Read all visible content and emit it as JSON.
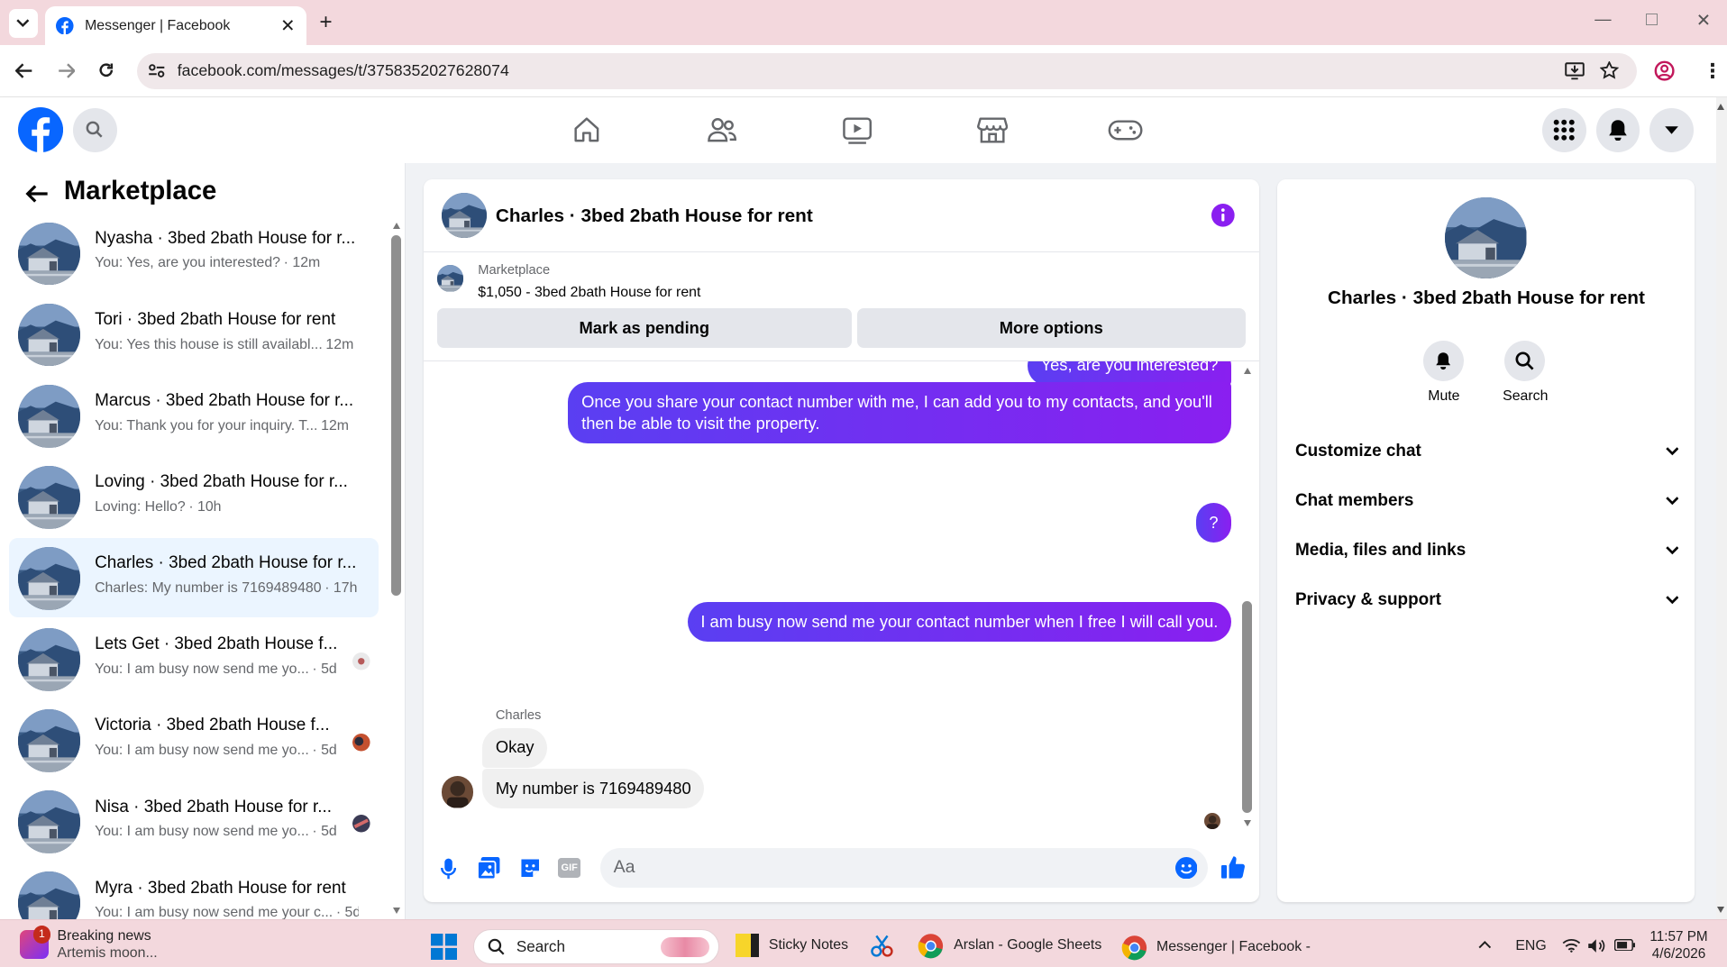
{
  "browser": {
    "tab_title": "Messenger | Facebook",
    "url": "facebook.com/messages/t/3758352027628074"
  },
  "sidebar": {
    "title": "Marketplace",
    "conversations": [
      {
        "name": "Nyasha · 3bed 2bath House for r...",
        "preview": "You: Yes, are you interested?",
        "time": "· 12m"
      },
      {
        "name": "Tori · 3bed 2bath House for rent",
        "preview": "You: Yes this house is still availabl...",
        "time": "12m"
      },
      {
        "name": "Marcus · 3bed 2bath House for r...",
        "preview": "You: Thank you for your inquiry. T...",
        "time": "12m"
      },
      {
        "name": "Loving · 3bed 2bath House for r...",
        "preview": "Loving: Hello?",
        "time": "· 10h"
      },
      {
        "name": "Charles · 3bed 2bath House for r...",
        "preview": "Charles: My number is 7169489480",
        "time": "· 17h"
      },
      {
        "name": "Lets Get · 3bed 2bath House f...",
        "preview": "You: I am busy now send me yo...",
        "time": "· 5d"
      },
      {
        "name": "Victoria · 3bed 2bath House f...",
        "preview": "You: I am busy now send me yo...",
        "time": "· 5d"
      },
      {
        "name": "Nisa · 3bed 2bath House for r...",
        "preview": "You: I am busy now send me yo...",
        "time": "· 5d"
      },
      {
        "name": "Myra · 3bed 2bath House for rent",
        "preview": "You: I am busy now send me your c...",
        "time": "· 5d"
      }
    ]
  },
  "chat": {
    "title": "Charles · 3bed 2bath House for rent",
    "listing_source": "Marketplace",
    "listing": "$1,050 - 3bed 2bath House for rent",
    "mark_pending": "Mark as pending",
    "more_options": "More options",
    "messages": {
      "partial": "Yes, are you interested?",
      "m1": "Once you share your contact number with me, I can add you to my contacts, and you'll then be able to visit the property.",
      "m2": "?",
      "m3": "I am busy now send me your contact number when I free I will call you.",
      "sender": "Charles",
      "m4": "Okay",
      "m5": "My number is 7169489480"
    },
    "composer_placeholder": "Aa"
  },
  "info": {
    "name": "Charles · 3bed 2bath House for rent",
    "mute": "Mute",
    "search": "Search",
    "sections": [
      "Customize chat",
      "Chat members",
      "Media, files and links",
      "Privacy & support"
    ]
  },
  "taskbar": {
    "news_title": "Breaking news",
    "news_sub": "Artemis moon...",
    "news_badge": "1",
    "search": "Search",
    "apps": [
      "Sticky Notes",
      "Arslan - Google Sheets",
      "Messenger | Facebook -"
    ],
    "lang": "ENG",
    "time": "11:57 PM",
    "date": "4/6/2026"
  },
  "colors": {
    "fb_blue": "#0866ff",
    "brand_purple": "#8a1ff0",
    "selected": "#ebf5ff"
  }
}
